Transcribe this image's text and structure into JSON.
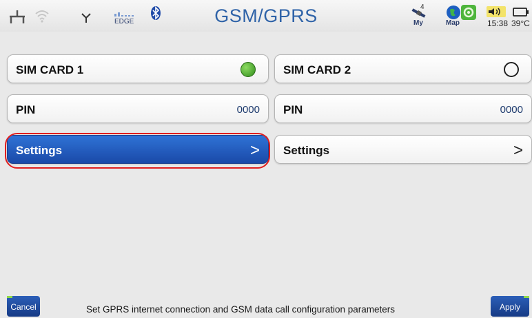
{
  "status_bar": {
    "title": "GSM/GPRS",
    "network_label": "EDGE",
    "satellites_count": "4",
    "my_label": "My",
    "map_label": "Map",
    "time": "15:38",
    "temperature": "39°C",
    "icons": [
      "ethernet-icon",
      "wifi-icon",
      "antenna-icon",
      "signal-bars-icon",
      "bluetooth-icon",
      "satellite-icon",
      "globe-map-icon",
      "settings-gear-icon",
      "speaker-icon",
      "battery-icon"
    ]
  },
  "sim1": {
    "card_label": "SIM CARD 1",
    "status": "active",
    "pin_label": "PIN",
    "pin_value": "0000",
    "settings_label": "Settings",
    "chevron": ">"
  },
  "sim2": {
    "card_label": "SIM CARD 2",
    "status": "inactive",
    "pin_label": "PIN",
    "pin_value": "0000",
    "settings_label": "Settings",
    "chevron": ">"
  },
  "footer": {
    "cancel_label": "Cancel",
    "hint": "Set GPRS internet connection and GSM data call configuration parameters",
    "apply_label": "Apply"
  },
  "colors": {
    "accent": "#1a49a8",
    "title": "#2f63a8",
    "highlight": "#e01f1f",
    "led_active": "#3fa326"
  }
}
